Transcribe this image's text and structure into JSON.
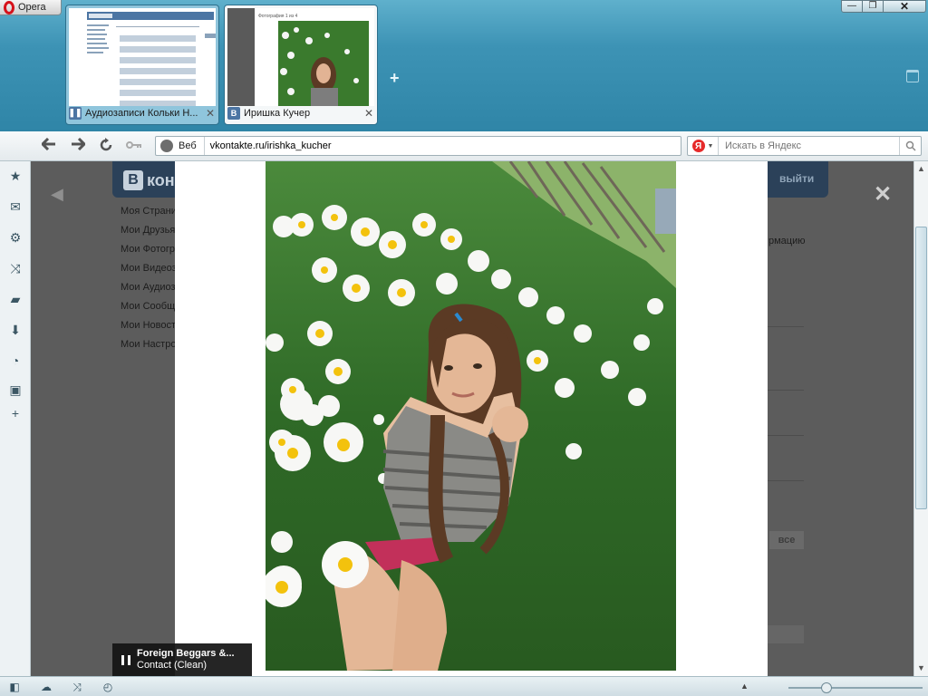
{
  "browser": {
    "menu_label": "Opera",
    "window_controls": {
      "minimize": "—",
      "maximize": "❐",
      "close": "✕"
    }
  },
  "tabs": [
    {
      "title": "Аудиозаписи Кольки Н...",
      "favicon": "pause-icon"
    },
    {
      "title": "Иришка Кучер",
      "favicon": "B"
    }
  ],
  "new_tab_label": "+",
  "address": {
    "scope": "Веб",
    "url": "vkontakte.ru/irishka_kucher"
  },
  "search": {
    "engine_letter": "Я",
    "placeholder": "Искать в Яндекс"
  },
  "vk": {
    "logo_letter": "В",
    "logo_text": "кон",
    "logout": "выйти",
    "menu": [
      "Моя Страни",
      "Мои Друзья",
      "Мои Фотогр",
      "Мои Видеоз",
      "Мои Аудиоз",
      "Мои Сообщ",
      "Мои Новост",
      "Мои Настро"
    ],
    "right_text": "рмацию",
    "all_button": "все"
  },
  "viewer": {
    "prev": "◀",
    "close": "✕"
  },
  "player": {
    "artist": "Foreign Beggars &...",
    "track": "Contact (Clean)"
  },
  "colors": {
    "vk_header": "#2b4159",
    "tab_bar": "#3d93b5",
    "overlay": "#5c5c5c"
  }
}
